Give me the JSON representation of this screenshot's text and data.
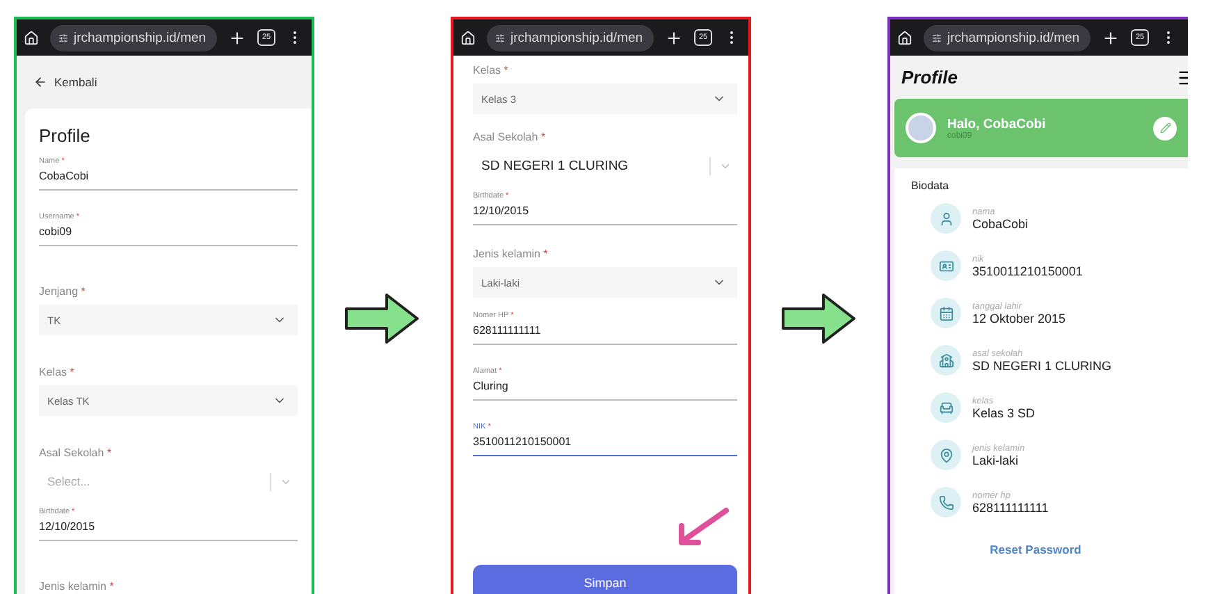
{
  "phones": [
    {
      "browser": {
        "url": "jrchampionship.id/men",
        "tab_count": "25"
      },
      "back_link": "Kembali",
      "title": "Profile",
      "fields": [
        {
          "kind": "text",
          "label": "Name",
          "required_mark": "*",
          "value": "CobaCobi",
          "focused": false
        },
        {
          "kind": "text",
          "label": "Username",
          "required_mark": "*",
          "value": "cobi09",
          "focused": false
        },
        {
          "kind": "select",
          "label": "Jenjang",
          "required_mark": "*",
          "value": "TK"
        },
        {
          "kind": "select",
          "label": "Kelas",
          "required_mark": "*",
          "value": "Kelas TK"
        },
        {
          "kind": "search",
          "label": "Asal Sekolah",
          "required_mark": "*",
          "placeholder": "Select..."
        },
        {
          "kind": "text",
          "label": "Birthdate",
          "required_mark": "*",
          "value": "12/10/2015",
          "focused": false
        },
        {
          "kind": "label",
          "label": "Jenis kelamin",
          "required_mark": "*"
        }
      ]
    },
    {
      "browser": {
        "url": "jrchampionship.id/men",
        "tab_count": "25"
      },
      "fields": [
        {
          "kind": "select",
          "label": "Kelas",
          "required_mark": "*",
          "value": "Kelas 3"
        },
        {
          "kind": "search",
          "label": "Asal Sekolah",
          "required_mark": "*",
          "value": "SD NEGERI 1 CLURING"
        },
        {
          "kind": "text",
          "label": "Birthdate",
          "required_mark": "*",
          "value": "12/10/2015",
          "focused": false
        },
        {
          "kind": "select",
          "label": "Jenis kelamin",
          "required_mark": "*",
          "value": "Laki-laki"
        },
        {
          "kind": "text",
          "label": "Nomer HP",
          "required_mark": "*",
          "value": "628111111111",
          "focused": false
        },
        {
          "kind": "text",
          "label": "Alamat",
          "required_mark": "*",
          "value": "Cluring",
          "focused": false
        },
        {
          "kind": "text",
          "label": "NIK",
          "required_mark": "*",
          "value": "3510011210150001",
          "focused": true
        }
      ],
      "submit": "Simpan"
    }
  ],
  "result": {
    "browser": {
      "url": "jrchampionship.id/men",
      "tab_count": "25"
    },
    "title": "Profile",
    "greeting": "Halo, CobaCobi",
    "username": "cobi09",
    "section": "Biodata",
    "rows": [
      {
        "label": "nama",
        "value": "CobaCobi"
      },
      {
        "label": "nik",
        "value": "3510011210150001"
      },
      {
        "label": "tanggal lahir",
        "value": "12 Oktober 2015"
      },
      {
        "label": "asal sekolah",
        "value": "SD NEGERI 1 CLURING"
      },
      {
        "label": "kelas",
        "value": "Kelas 3 SD"
      },
      {
        "label": "jenis kelamin",
        "value": "Laki-laki"
      },
      {
        "label": "nomer hp",
        "value": "628111111111"
      }
    ],
    "reset_link": "Reset Password"
  }
}
